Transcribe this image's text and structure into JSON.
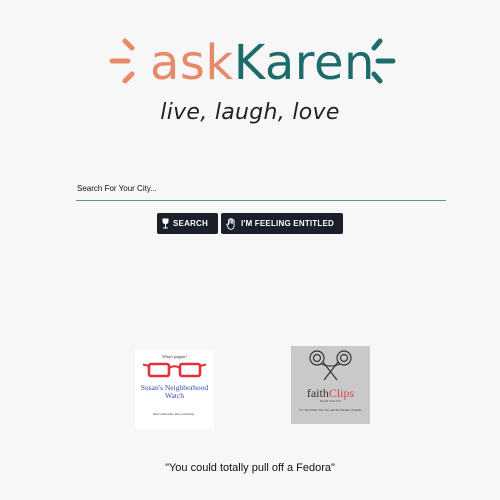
{
  "logo": {
    "ask": "ask",
    "name": "Karen",
    "colors": {
      "ask": "#e8896a",
      "name": "#1e6b6b"
    }
  },
  "tagline": "live, laugh, love",
  "search": {
    "placeholder": "Search For Your City..."
  },
  "buttons": {
    "search_label": "SEARCH",
    "lucky_label": "I'M FEELING ENTITLED",
    "search_icon": "wine-glass-icon",
    "lucky_icon": "raised-hand-icon"
  },
  "promos": {
    "susan": {
      "top_text": "What's poppin?",
      "name": "Susan's Neighborhood Watch",
      "sub_text": "Don't mind me just watching..."
    },
    "faith": {
      "brand_a": "faith",
      "brand_b": "Clips",
      "salon": "HAIR SALON",
      "sub_text": "For The Father, The Son, and The Mother of Spirits"
    }
  },
  "quote": "\"You could totally pull off a Fedora\""
}
